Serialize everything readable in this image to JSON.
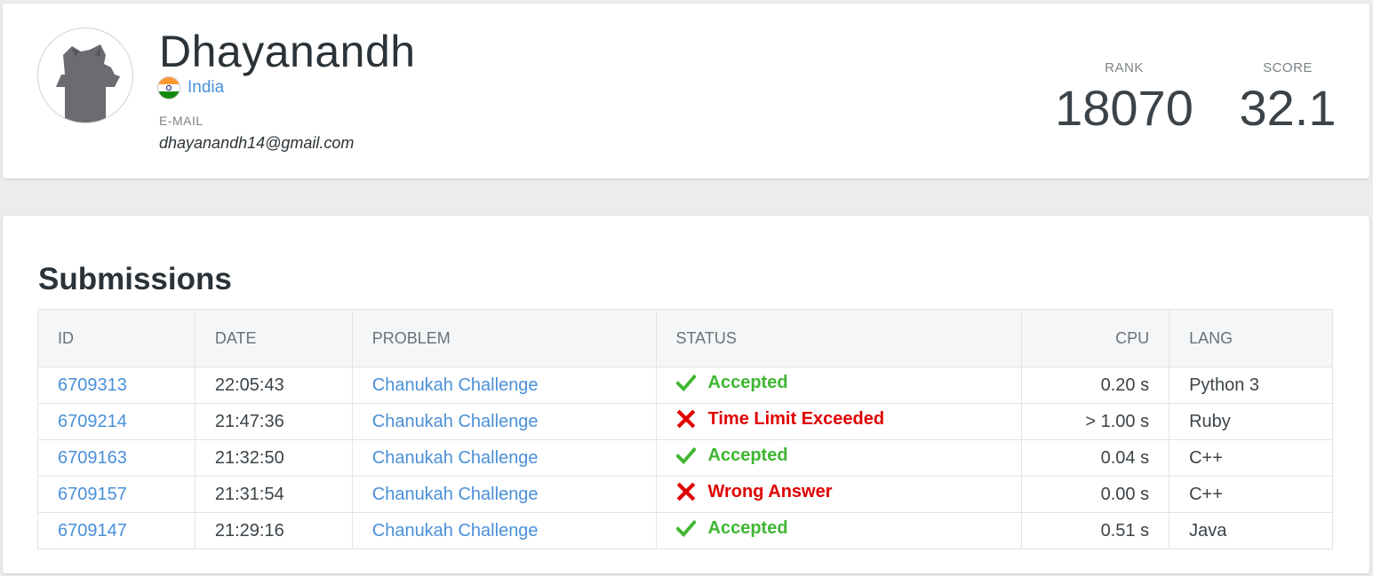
{
  "profile": {
    "username": "Dhayanandh",
    "country": "India",
    "email_label": "E-MAIL",
    "email": "dhayanandh14@gmail.com",
    "rank_label": "RANK",
    "rank": "18070",
    "score_label": "SCORE",
    "score": "32.1"
  },
  "submissions": {
    "title": "Submissions",
    "columns": {
      "id": "ID",
      "date": "DATE",
      "problem": "PROBLEM",
      "status": "STATUS",
      "cpu": "CPU",
      "lang": "LANG"
    },
    "rows": [
      {
        "id": "6709313",
        "date": "22:05:43",
        "problem": "Chanukah Challenge",
        "status": "Accepted",
        "status_type": "accepted",
        "cpu": "0.20 s",
        "lang": "Python 3"
      },
      {
        "id": "6709214",
        "date": "21:47:36",
        "problem": "Chanukah Challenge",
        "status": "Time Limit Exceeded",
        "status_type": "rejected",
        "cpu": "> 1.00 s",
        "lang": "Ruby"
      },
      {
        "id": "6709163",
        "date": "21:32:50",
        "problem": "Chanukah Challenge",
        "status": "Accepted",
        "status_type": "accepted",
        "cpu": "0.04 s",
        "lang": "C++"
      },
      {
        "id": "6709157",
        "date": "21:31:54",
        "problem": "Chanukah Challenge",
        "status": "Wrong Answer",
        "status_type": "rejected",
        "cpu": "0.00 s",
        "lang": "C++"
      },
      {
        "id": "6709147",
        "date": "21:29:16",
        "problem": "Chanukah Challenge",
        "status": "Accepted",
        "status_type": "accepted",
        "cpu": "0.51 s",
        "lang": "Java"
      }
    ]
  },
  "colors": {
    "link": "#4a90d9",
    "accepted": "#3fb632",
    "rejected": "#e00000"
  },
  "icons": {
    "avatar": "cat-avatar-icon",
    "flag": "india-flag-icon",
    "accepted": "check-icon",
    "rejected": "cross-icon"
  }
}
